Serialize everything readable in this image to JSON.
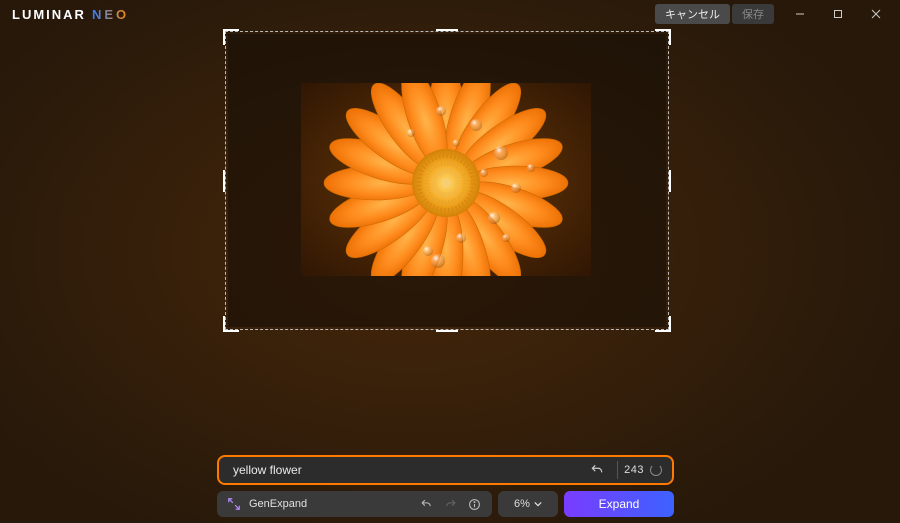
{
  "app": {
    "name_primary": "LUMINAR",
    "name_secondary": "NEO",
    "cancel_label": "キャンセル",
    "save_label": "保存"
  },
  "prompt": {
    "value": "yellow flower",
    "token_count": "243"
  },
  "tool": {
    "name": "GenExpand",
    "zoom_label": "6%",
    "action_label": "Expand"
  },
  "colors": {
    "accent_orange": "#ff7a00",
    "expand_gradient_start": "#7a3cff",
    "expand_gradient_end": "#3d62ff"
  }
}
